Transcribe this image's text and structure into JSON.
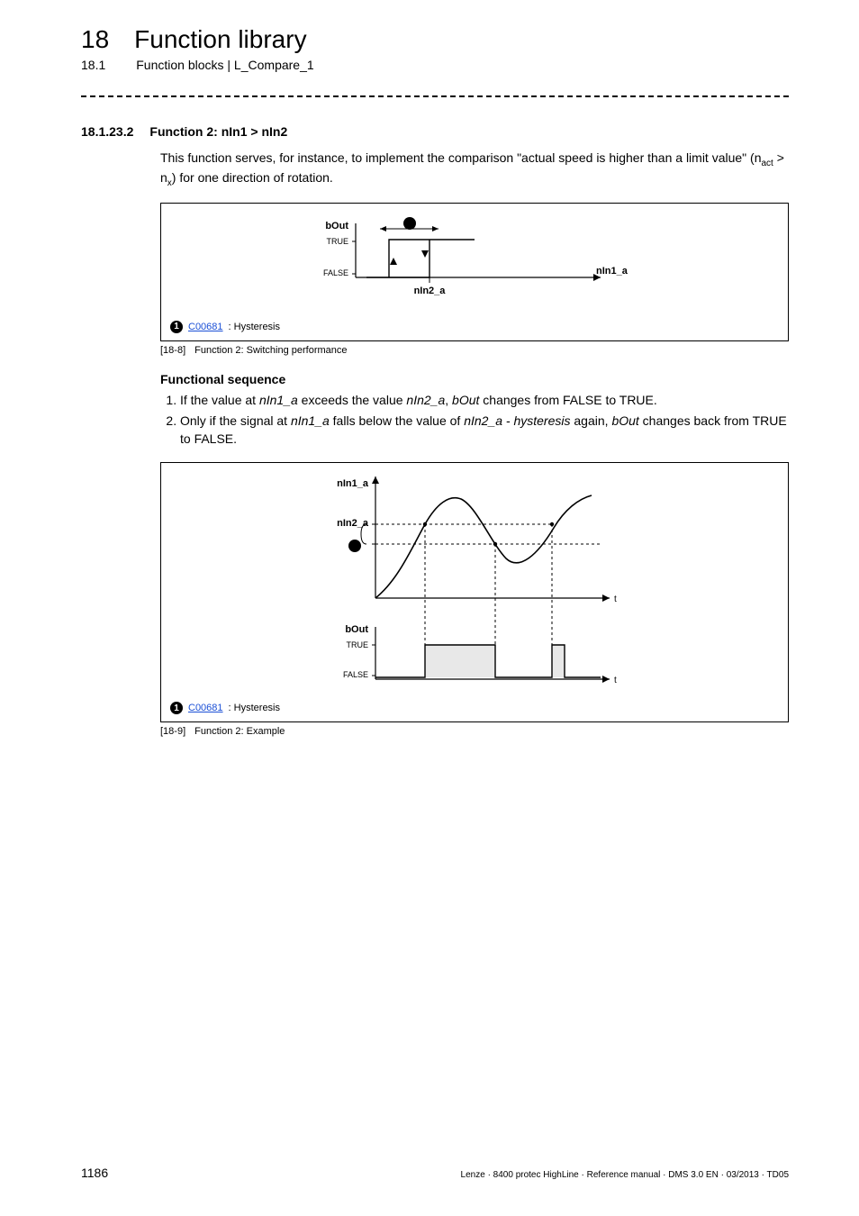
{
  "header": {
    "chapter_num": "18",
    "chapter_title": "Function library",
    "section_num": "18.1",
    "section_title": "Function blocks | L_Compare_1"
  },
  "section": {
    "num": "18.1.23.2",
    "title": "Function 2: nIn1 > nIn2",
    "intro_html": "This function serves, for instance, to implement the comparison \"actual speed  is higher than a limit value\" (n<sub>act</sub> > n<sub>x</sub>) for one direction of rotation."
  },
  "figure1": {
    "tag": "[18-8]",
    "caption": "Function 2: Switching performance",
    "legend_badge": "1",
    "legend_code": "C00681",
    "legend_text": ": Hysteresis",
    "labels": {
      "bOut": "bOut",
      "TRUE": "TRUE",
      "FALSE": "FALSE",
      "nIn2_a": "nIn2_a",
      "nIn1_a": "nIn1_a",
      "badge": "1"
    }
  },
  "func_seq": {
    "heading": "Functional sequence",
    "items": [
      "If the value at <em>nIn1_a</em> exceeds the value <em>nIn2_a</em>, <em>bOut</em> changes from FALSE to TRUE.",
      "Only if the signal at <em>nIn1_a</em> falls below the value of <em>nIn2_a - hysteresis</em> again, <em>bOut</em> changes back from TRUE to FALSE."
    ]
  },
  "figure2": {
    "tag": "[18-9]",
    "caption": "Function 2: Example",
    "legend_badge": "1",
    "legend_code": "C00681",
    "legend_text": ": Hysteresis",
    "labels": {
      "nIn1_a": "nIn1_a",
      "nIn2_a": "nIn2_a",
      "bOut": "bOut",
      "TRUE": "TRUE",
      "FALSE": "FALSE",
      "t": "t",
      "badge": "1"
    }
  },
  "footer": {
    "page": "1186",
    "docinfo": "Lenze · 8400 protec HighLine · Reference manual · DMS 3.0 EN · 03/2013 · TD05"
  },
  "chart_data": [
    {
      "type": "line",
      "title": "Function 2: Switching performance",
      "description": "bOut step response with hysteresis around nIn2_a threshold along nIn1_a axis",
      "xlabel": "nIn1_a",
      "ylabel": "bOut",
      "y_categories": [
        "FALSE",
        "TRUE"
      ],
      "thresholds": {
        "rising_trip": "nIn2_a",
        "falling_trip": "nIn2_a - hysteresis"
      },
      "series": [
        {
          "name": "bOut (rising nIn1_a)",
          "points": [
            {
              "x": "0",
              "y": "FALSE"
            },
            {
              "x": "nIn2_a",
              "y": "FALSE"
            },
            {
              "x": "nIn2_a",
              "y": "TRUE"
            },
            {
              "x": "max",
              "y": "TRUE"
            }
          ]
        },
        {
          "name": "bOut (falling nIn1_a)",
          "points": [
            {
              "x": "max",
              "y": "TRUE"
            },
            {
              "x": "nIn2_a - hyst",
              "y": "TRUE"
            },
            {
              "x": "nIn2_a - hyst",
              "y": "FALSE"
            },
            {
              "x": "0",
              "y": "FALSE"
            }
          ]
        }
      ],
      "annotations": [
        {
          "label": "1",
          "meaning": "hysteresis width between rising and falling trip points"
        }
      ]
    },
    {
      "type": "line",
      "title": "Function 2: Example",
      "description": "Time-domain example: nIn1_a curve crossing nIn2_a and nIn2_a - hysteresis, with resulting bOut pulses",
      "xlabel": "t",
      "panels": [
        {
          "ylabel": "nIn1_a",
          "reference_levels": {
            "nIn2_a": 1.0,
            "nIn2_a_minus_hysteresis": 0.8
          },
          "series": [
            {
              "name": "nIn1_a(t)",
              "x": [
                0.0,
                0.1,
                0.2,
                0.3,
                0.4,
                0.5,
                0.6,
                0.7,
                0.8,
                0.9,
                1.0
              ],
              "y": [
                0.0,
                0.35,
                0.8,
                1.1,
                1.25,
                1.05,
                0.78,
                0.7,
                0.88,
                1.05,
                1.2
              ]
            }
          ],
          "events": {
            "rise_cross_nIn2_a": 0.27,
            "fall_cross_hysteresis": 0.62,
            "second_rise_cross_nIn2_a": 0.88
          }
        },
        {
          "ylabel": "bOut",
          "y_categories": [
            "FALSE",
            "TRUE"
          ],
          "series": [
            {
              "name": "bOut(t)",
              "x": [
                0.0,
                0.27,
                0.27,
                0.62,
                0.62,
                0.88,
                0.88,
                1.0
              ],
              "y": [
                "FALSE",
                "FALSE",
                "TRUE",
                "TRUE",
                "FALSE",
                "FALSE",
                "TRUE",
                "TRUE"
              ]
            }
          ]
        }
      ],
      "annotations": [
        {
          "label": "1",
          "meaning": "hysteresis band between nIn2_a and nIn2_a - hysteresis"
        }
      ]
    }
  ]
}
